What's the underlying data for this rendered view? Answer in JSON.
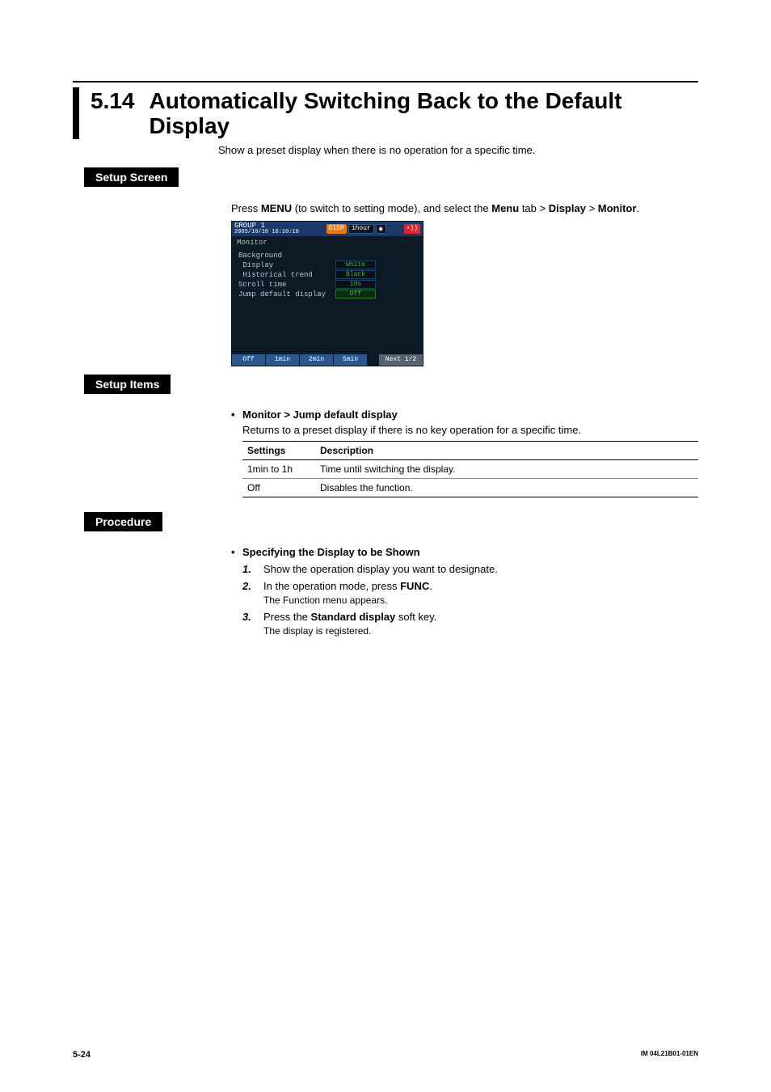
{
  "section": {
    "number": "5.14",
    "title": "Automatically Switching Back to the Default Display"
  },
  "lead": "Show a preset display when there is no operation for a specific time.",
  "labels": {
    "setup_screen": "Setup Screen",
    "setup_items": "Setup Items",
    "procedure": "Procedure"
  },
  "setup_screen": {
    "instr_pre": "Press ",
    "menu": "MENU",
    "instr_mid1": " (to switch to setting mode), and select the ",
    "menu_tab": "Menu",
    "instr_mid2": " tab > ",
    "display": "Display",
    "instr_mid3": " > ",
    "monitor": "Monitor",
    "instr_post": "."
  },
  "device": {
    "group": "GROUP 1",
    "datetime": "2005/10/10 10:10:10",
    "disp_badge": "DISP",
    "interval": "1hour",
    "heading": "Monitor",
    "rows": {
      "background": "Background",
      "display": " Display",
      "display_val": "White",
      "hist": " Historical trend",
      "hist_val": "Black",
      "scroll": "Scroll time",
      "scroll_val": "10s",
      "jump": "Jump default display",
      "jump_val": "Off"
    },
    "softkeys": [
      "Off",
      "1min",
      "2min",
      "5min"
    ],
    "next": "Next 1/2"
  },
  "setup_items": {
    "heading": "Monitor > Jump default display",
    "desc": "Returns to a preset display if there is no key operation for a specific time.",
    "table": {
      "h1": "Settings",
      "h2": "Description",
      "rows": [
        {
          "s": "1min to 1h",
          "d": "Time until switching the display."
        },
        {
          "s": "Off",
          "d": "Disables the function."
        }
      ]
    }
  },
  "procedure": {
    "heading": "Specifying the Display to be Shown",
    "steps": [
      {
        "n": "1.",
        "t": "Show the operation display you want to designate.",
        "sub": ""
      },
      {
        "n": "2.",
        "t_pre": "In the operation mode, press ",
        "t_bold": "FUNC",
        "t_post": ".",
        "sub": "The Function menu appears."
      },
      {
        "n": "3.",
        "t_pre": "Press the ",
        "t_bold": "Standard display",
        "t_post": " soft key.",
        "sub": "The display is registered."
      }
    ]
  },
  "footer": {
    "page": "5-24",
    "docid": "IM 04L21B01-01EN"
  }
}
